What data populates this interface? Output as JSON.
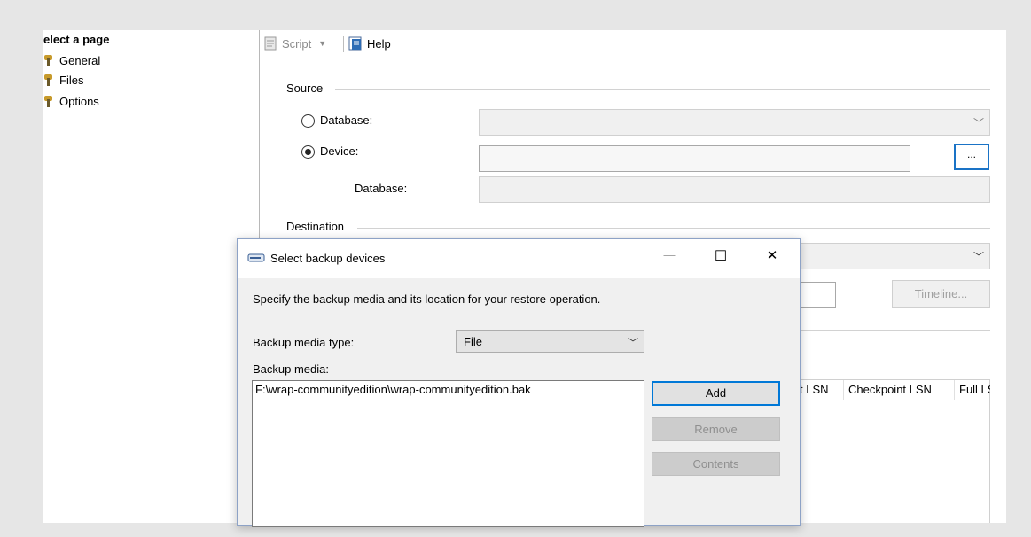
{
  "left_pane": {
    "header": "elect a page",
    "items": [
      {
        "label": "General"
      },
      {
        "label": "Files"
      },
      {
        "label": "Options"
      }
    ]
  },
  "toolbar": {
    "script_label": "Script",
    "help_label": "Help"
  },
  "source": {
    "group_label": "Source",
    "database_radio_label": "Database:",
    "device_radio_label": "Device:",
    "device_value": "",
    "device_browse_label": "...",
    "database_label": "Database:",
    "database_value": "",
    "selected": "Device"
  },
  "destination": {
    "group_label": "Destination",
    "timeline_label": "Timeline..."
  },
  "backup_sets_table": {
    "columns": [
      "t LSN",
      "Checkpoint LSN",
      "Full LS"
    ]
  },
  "dialog": {
    "title": "Select backup devices",
    "description": "Specify the backup media and its location for your restore operation.",
    "media_type_label": "Backup media type:",
    "media_type_value": "File",
    "media_label": "Backup media:",
    "media_items": [
      "F:\\wrap-communityedition\\wrap-communityedition.bak"
    ],
    "add_label": "Add",
    "remove_label": "Remove",
    "contents_label": "Contents",
    "minimize_glyph": "—",
    "maximize_glyph": "☐",
    "close_glyph": "✕"
  }
}
